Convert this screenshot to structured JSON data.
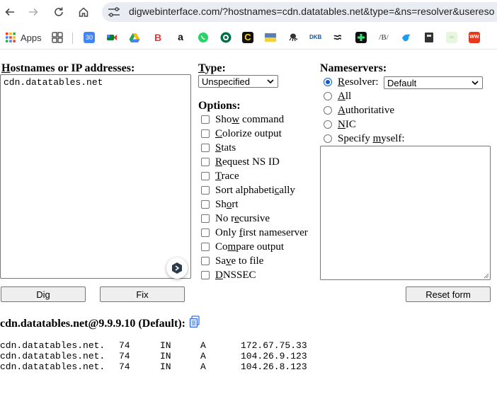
{
  "browser": {
    "url": "digwebinterface.com/?hostnames=cdn.datatables.net&type=&ns=resolver&usereso",
    "bookmarks": {
      "apps_label": "Apps",
      "items": [
        "calendar-icon",
        "meet-icon",
        "drive-icon",
        "bold-b-icon",
        "amazon-icon",
        "whatsapp-icon",
        "starbucks-icon",
        "c-icon",
        "flag-icon",
        "octopus-icon",
        "dkb-icon",
        "tide-icon",
        "plus-icon",
        "b-icon",
        "bird-icon",
        "book-icon",
        "image-icon",
        "ww-icon"
      ],
      "calendar_text": "30",
      "dkb_text": "DKB",
      "ww_text": "WW"
    }
  },
  "form": {
    "hostnames_label": "Hostnames or IP addresses:",
    "hostnames_value": "cdn.datatables.net",
    "type_label": "Type:",
    "type_value": "Unspecified",
    "options_label": "Options:",
    "options": [
      {
        "label": "Show command",
        "checked": false
      },
      {
        "label": "Colorize output",
        "checked": false
      },
      {
        "label": "Stats",
        "checked": false
      },
      {
        "label": "Request NS ID",
        "checked": false
      },
      {
        "label": "Trace",
        "checked": false
      },
      {
        "label": "Sort alphabetically",
        "checked": false
      },
      {
        "label": "Short",
        "checked": false
      },
      {
        "label": "No recursive",
        "checked": false
      },
      {
        "label": "Only first nameserver",
        "checked": false
      },
      {
        "label": "Compare output",
        "checked": false
      },
      {
        "label": "Save to file",
        "checked": false
      },
      {
        "label": "DNSSEC",
        "checked": false
      }
    ],
    "nameservers_label": "Nameservers:",
    "ns_options": [
      {
        "label": "Resolver:",
        "selected": true
      },
      {
        "label": "All",
        "selected": false
      },
      {
        "label": "Authoritative",
        "selected": false
      },
      {
        "label": "NIC",
        "selected": false
      },
      {
        "label": "Specify myself:",
        "selected": false
      }
    ],
    "resolver_value": "Default",
    "buttons": {
      "dig": "Dig",
      "fix": "Fix",
      "reset": "Reset form"
    }
  },
  "result": {
    "heading": "cdn.datatables.net@9.9.9.10 (Default):",
    "rows": [
      {
        "name": "cdn.datatables.net.",
        "ttl": "74",
        "class": "IN",
        "type": "A",
        "value": "172.67.75.33"
      },
      {
        "name": "cdn.datatables.net.",
        "ttl": "74",
        "class": "IN",
        "type": "A",
        "value": "104.26.9.123"
      },
      {
        "name": "cdn.datatables.net.",
        "ttl": "74",
        "class": "IN",
        "type": "A",
        "value": "104.26.8.123"
      }
    ]
  }
}
